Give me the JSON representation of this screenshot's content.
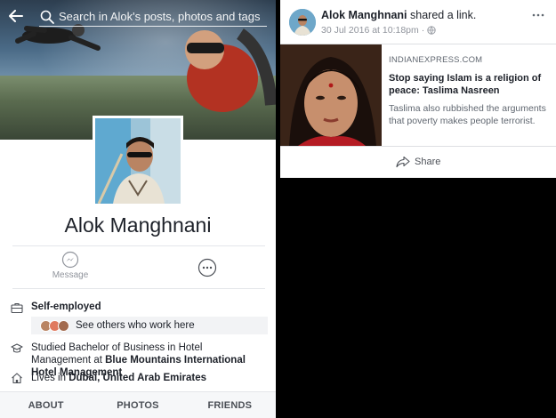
{
  "left_panel": {
    "search": {
      "placeholder": "Search in Alok's posts, photos and tags"
    },
    "profile_name": "Alok Manghnani",
    "actions": {
      "message_label": "Message"
    },
    "about": {
      "work_title": "Self-employed",
      "work_sub": "See others who work here",
      "education_prefix": "Studied Bachelor of Business in Hotel Management at ",
      "education_school": "Blue Mountains International Hotel Management",
      "lives_prefix": "Lives in ",
      "lives_place": "Dubai, United Arab Emirates"
    },
    "tabs": [
      "ABOUT",
      "PHOTOS",
      "FRIENDS"
    ]
  },
  "post": {
    "author": "Alok Manghnani",
    "action_text": " shared a link.",
    "date": "30 Jul 2016 at 10:18pm",
    "separator": "·",
    "privacy_icon": "globe-icon",
    "link": {
      "source": "INDIANEXPRESS.COM",
      "title": "Stop saying Islam is a religion of peace: Taslima Nasreen",
      "description": "Taslima also rubbished the arguments that poverty makes people terrorist."
    },
    "share_label": "Share"
  },
  "colors": {
    "text_primary": "#1d2129",
    "text_secondary": "#90949c",
    "divider": "#e4e6ea",
    "tab_bg": "#f6f7f9"
  }
}
